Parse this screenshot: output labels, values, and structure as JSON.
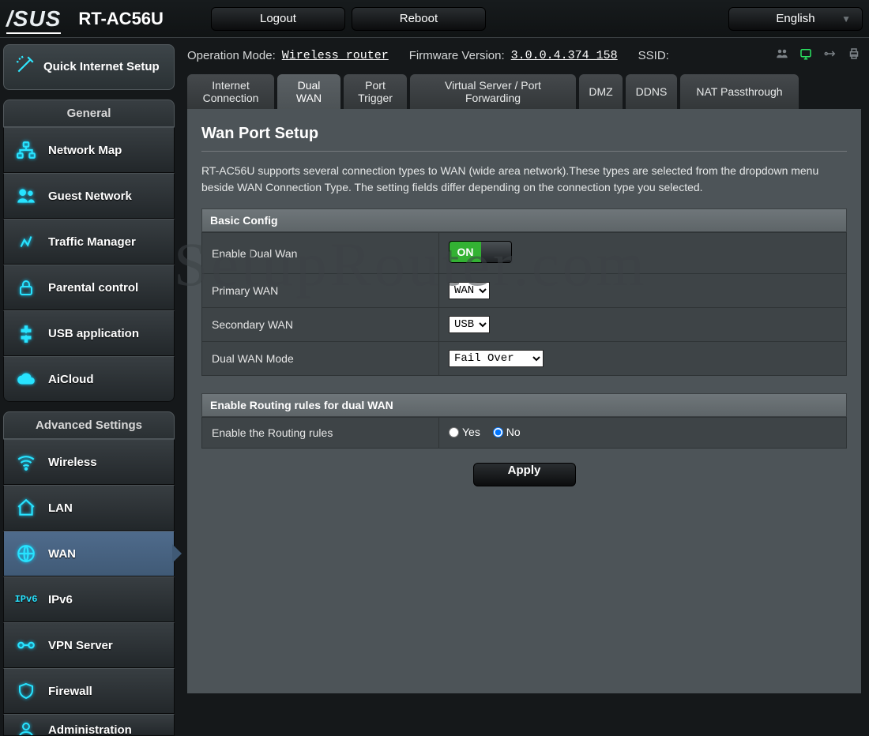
{
  "header": {
    "brand": "/SUS",
    "model": "RT-AC56U",
    "logout": "Logout",
    "reboot": "Reboot",
    "language": "English"
  },
  "status": {
    "op_mode_label": "Operation Mode:",
    "op_mode_value": "Wireless router",
    "fw_label": "Firmware Version:",
    "fw_value": "3.0.0.4.374_158",
    "ssid_label": "SSID:"
  },
  "sidebar": {
    "qis": "Quick Internet Setup",
    "general_head": "General",
    "general": [
      "Network Map",
      "Guest Network",
      "Traffic Manager",
      "Parental control",
      "USB application",
      "AiCloud"
    ],
    "advanced_head": "Advanced Settings",
    "advanced": [
      "Wireless",
      "LAN",
      "WAN",
      "IPv6",
      "VPN Server",
      "Firewall",
      "Administration"
    ],
    "active_advanced_index": 2
  },
  "tabs": [
    "Internet Connection",
    "Dual WAN",
    "Port Trigger",
    "Virtual Server / Port Forwarding",
    "DMZ",
    "DDNS",
    "NAT Passthrough"
  ],
  "active_tab_index": 1,
  "page": {
    "title": "Wan Port Setup",
    "description": "RT-AC56U supports several connection types to WAN (wide area network).These types are selected from the dropdown menu beside WAN Connection Type. The setting fields differ depending on the connection type you selected.",
    "basic_head": "Basic Config",
    "rows": {
      "enable_dual_wan": "Enable Dual Wan",
      "primary_wan": "Primary WAN",
      "secondary_wan": "Secondary WAN",
      "dual_wan_mode": "Dual WAN Mode"
    },
    "values": {
      "toggle_on_label": "ON",
      "primary_wan": "WAN",
      "secondary_wan": "USB",
      "dual_wan_mode": "Fail Over"
    },
    "routing_head": "Enable Routing rules for dual WAN",
    "routing_row": "Enable the Routing rules",
    "radio_yes": "Yes",
    "radio_no": "No",
    "routing_selected": "No",
    "apply": "Apply"
  },
  "watermark": "SetupRouter.com"
}
